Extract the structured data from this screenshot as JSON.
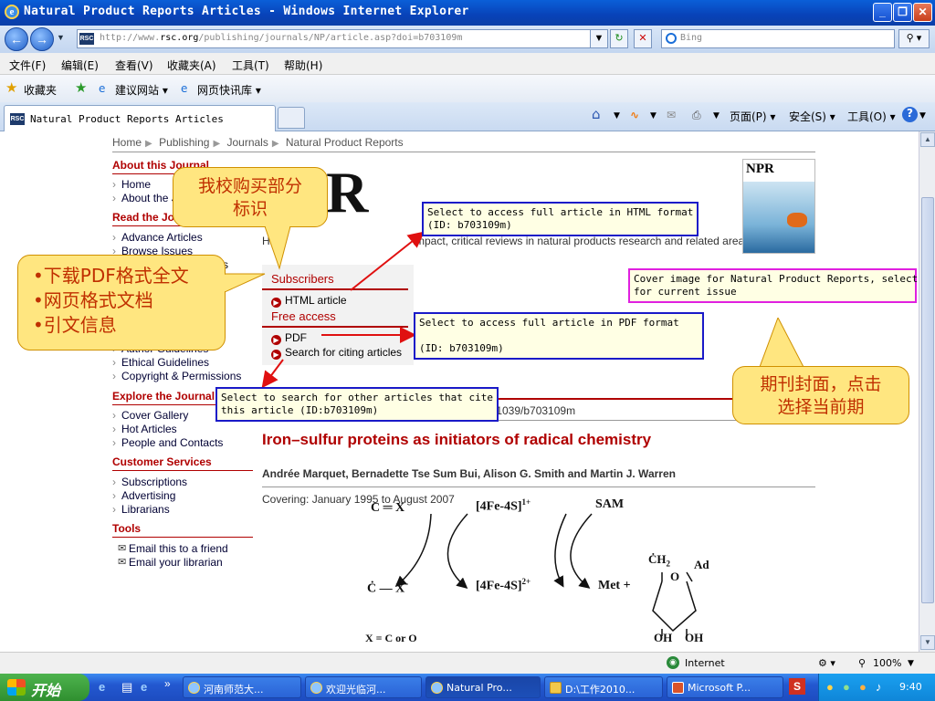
{
  "window": {
    "title": "Natural Product Reports Articles - Windows Internet Explorer",
    "minimize": "_",
    "restore": "❐",
    "close": "✕"
  },
  "address_bar": {
    "url_prefix": "http://www.",
    "url_domain": "rsc.org",
    "url_rest": "/publishing/journals/NP/article.asp?doi=b703109m",
    "search_placeholder": "Bing",
    "site_icon": "RSC"
  },
  "menu_bar": [
    "文件(F)",
    "编辑(E)",
    "查看(V)",
    "收藏夹(A)",
    "工具(T)",
    "帮助(H)"
  ],
  "favorites_bar": {
    "favorites": "收藏夹",
    "suggested": "建议网站 ▾",
    "webslice": "网页快讯库 ▾"
  },
  "tab": {
    "label": "Natural Product Reports Articles",
    "tools": [
      "页面(P) ▾",
      "安全(S) ▾",
      "工具(O) ▾"
    ]
  },
  "breadcrumb": [
    "Home",
    "Publishing",
    "Journals",
    "Natural Product Reports"
  ],
  "sidebar": {
    "about_heading": "About this Journal",
    "about_links": [
      "Home",
      "About the J"
    ],
    "read_heading": "Read the Jo",
    "read_links": [
      "Advance Articles",
      "Browse Issues",
      "s"
    ],
    "hidden_links": [
      "Author Guidelines",
      "Ethical Guidelines",
      "Copyright & Permissions"
    ],
    "explore_heading": "Explore the Journal",
    "explore_links": [
      "Cover Gallery",
      "Hot Articles",
      "People and Contacts"
    ],
    "customer_heading": "Customer Services",
    "customer_links": [
      "Subscriptions",
      "Advertising",
      "Librarians"
    ],
    "tools_heading": "Tools",
    "tools_links": [
      "Email this to a friend",
      "Email your librarian"
    ]
  },
  "journal": {
    "logo": "PR",
    "tagline_start": "Hi",
    "tagline_end": "impact, critical reviews in natural products research and related areas",
    "cover_title": "NPR"
  },
  "access_box": {
    "subscribers": "Subscribers",
    "html_article": "HTML article",
    "free_access": "Free access",
    "pdf": "PDF",
    "citing": "Search for citing articles"
  },
  "article": {
    "doi": ".1039/b703109m",
    "title": "Iron–sulfur proteins as initiators of radical chemistry",
    "authors": "Andrée Marquet, Bernadette Tse Sum Bui, Alison G. Smith and Martin J. Warren",
    "covering": "Covering: January 1995 to August 2007"
  },
  "tooltips": {
    "html": "Select to access full article in HTML format\n(ID: b703109m)",
    "pdf": "Select to access full article in PDF format\n\n(ID: b703109m)",
    "cite": "Select to search for other articles that cite\nthis article (ID:b703109m)",
    "cover": "Cover image for Natural Product Reports, select\nfor current issue"
  },
  "callouts": {
    "purchase": "我校购买部分\n标识",
    "features": [
      "•下载PDF格式全文",
      "•网页格式文档",
      "•引文信息"
    ],
    "cover": "期刊封面，点击\n选择当前期"
  },
  "scheme": {
    "c_eq_x": "C ═ X",
    "fe1": "[4Fe-4S]",
    "fe1_sup": "1+",
    "sam": "SAM",
    "c_x_rad": "Ċ — X",
    "c_x_sup": "-",
    "fe2": "[4Fe-4S]",
    "fe2_sup": "2+",
    "met": "Met  +",
    "ch2": "ĊH",
    "ch2_sub": "2",
    "ad": "Ad",
    "o": "O",
    "oh1": "OH",
    "oh2": "OH",
    "xco": "X = C or O"
  },
  "status_bar": {
    "zone": "Internet",
    "zoom": "100%"
  },
  "taskbar": {
    "start": "开始",
    "tasks": [
      "河南师范大...",
      "欢迎光临河...",
      "Natural Pro...",
      "D:\\工作2010...",
      "Microsoft P..."
    ],
    "clock": "9:40"
  },
  "colors": {
    "accent_red": "#b00000",
    "callout_fill": "#ffe680",
    "tooltip_border_blue": "#1a1ac8",
    "tooltip_border_pink": "#e020e0"
  }
}
